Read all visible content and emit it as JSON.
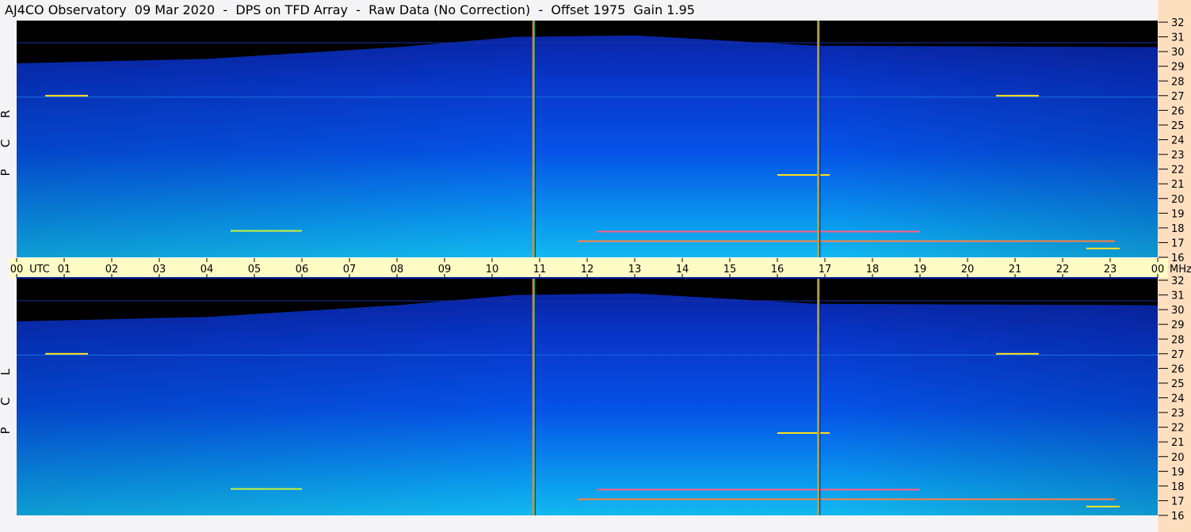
{
  "title": "AJ4CO Observatory  09 Mar 2020  -  DPS on TFD Array  -  Raw Data (No Correction)  -  Offset 1975  Gain 1.95",
  "chart_data": {
    "type": "heatmap",
    "title": "AJ4CO Observatory  09 Mar 2020  -  DPS on TFD Array  -  Raw Data (No Correction)  -  Offset 1975  Gain 1.95",
    "xlabel": "UTC",
    "ylabel": "MHz",
    "xlim": [
      0,
      24
    ],
    "ylim": [
      16,
      32
    ],
    "x_tick_labels": [
      "00",
      "01",
      "02",
      "03",
      "04",
      "05",
      "06",
      "07",
      "08",
      "09",
      "10",
      "11",
      "12",
      "13",
      "14",
      "15",
      "16",
      "17",
      "18",
      "19",
      "20",
      "21",
      "22",
      "23",
      "00"
    ],
    "x_unit_label": "UTC",
    "y_unit_label": "MHz",
    "y_tick_labels": [
      "16",
      "17",
      "18",
      "19",
      "20",
      "21",
      "22",
      "23",
      "24",
      "25",
      "26",
      "27",
      "28",
      "29",
      "30",
      "31",
      "32"
    ],
    "panels": [
      {
        "name": "RCP",
        "letters": [
          "R",
          "C",
          "P"
        ]
      },
      {
        "name": "LCP",
        "letters": [
          "L",
          "C",
          "P"
        ]
      }
    ],
    "colors": {
      "low": "#000000",
      "dark": "#0a1f9a",
      "mid": "#0552e6",
      "high": "#12b8f0",
      "hot": "#ffe020",
      "peak": "#ff40c0"
    },
    "noise_floor_upper_edge_mhz": [
      [
        0,
        29.2
      ],
      [
        4,
        29.5
      ],
      [
        8,
        30.3
      ],
      [
        10.5,
        31.0
      ],
      [
        13,
        31.1
      ],
      [
        16.8,
        30.4
      ],
      [
        24,
        30.3
      ]
    ],
    "vertical_interference_hours": [
      10.88,
      16.87
    ],
    "horizontal_signals": [
      {
        "mhz": 27.0,
        "start": 0.6,
        "end": 1.5,
        "color": "#ffe020"
      },
      {
        "mhz": 17.8,
        "start": 4.5,
        "end": 6.0,
        "color": "#c8f040"
      },
      {
        "mhz": 17.75,
        "start": 12.2,
        "end": 19.0,
        "color": "#ff6080"
      },
      {
        "mhz": 17.1,
        "start": 11.8,
        "end": 23.1,
        "color": "#ff8040"
      },
      {
        "mhz": 21.6,
        "start": 16.0,
        "end": 17.1,
        "color": "#ffe020"
      },
      {
        "mhz": 27.0,
        "start": 20.6,
        "end": 21.5,
        "color": "#ffe020"
      },
      {
        "mhz": 16.6,
        "start": 22.5,
        "end": 23.2,
        "color": "#ffe020"
      }
    ]
  }
}
